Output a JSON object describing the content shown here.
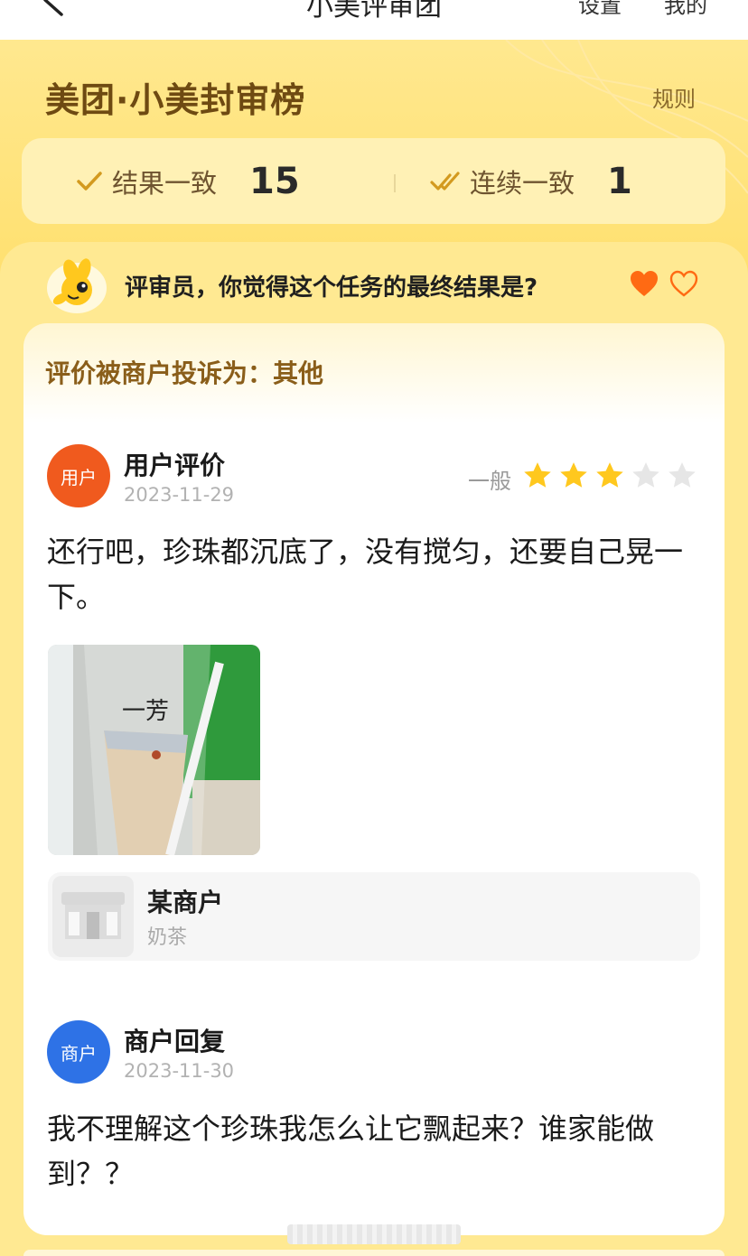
{
  "nav": {
    "title": "小美评审团",
    "settings": "设置",
    "mine": "我的"
  },
  "header": {
    "brand_title": "美团·小美封审榜",
    "rules": "规则"
  },
  "stats": {
    "consistent_label": "结果一致",
    "consistent_value": "15",
    "streak_label": "连续一致",
    "streak_value": "1"
  },
  "question": {
    "text": "评审员，你觉得这个任务的最终结果是?"
  },
  "complaint": {
    "text": "评价被商户投诉为：其他"
  },
  "user_review": {
    "avatar_label": "用户",
    "title": "用户评价",
    "date": "2023-11-29",
    "rating_word": "一般",
    "rating": 3,
    "rating_max": 5,
    "text": "还行吧，珍珠都沉底了，没有搅匀，还要自己晃一下。",
    "photo_text": "一芳"
  },
  "merchant": {
    "name": "某商户",
    "category": "奶茶"
  },
  "merchant_reply": {
    "avatar_label": "商户",
    "title": "商户回复",
    "date": "2023-11-30",
    "text": "我不理解这个珍珠我怎么让它飘起来？谁家能做到？？"
  },
  "colors": {
    "banner_yellow": "#ffe27a",
    "brand_brown": "#6e4a12",
    "heart_orange": "#ff6a13",
    "star_yellow": "#ffc81e",
    "star_grey": "#e6e6e6",
    "user_avatar": "#f05a1e",
    "merchant_avatar": "#2e72e6"
  },
  "icons": {
    "back": "chevron-left-icon",
    "check": "check-icon",
    "double_check": "double-check-icon",
    "heart_filled": "heart-filled-icon",
    "heart_outline": "heart-outline-icon",
    "star": "star-icon",
    "shop": "storefront-icon"
  }
}
